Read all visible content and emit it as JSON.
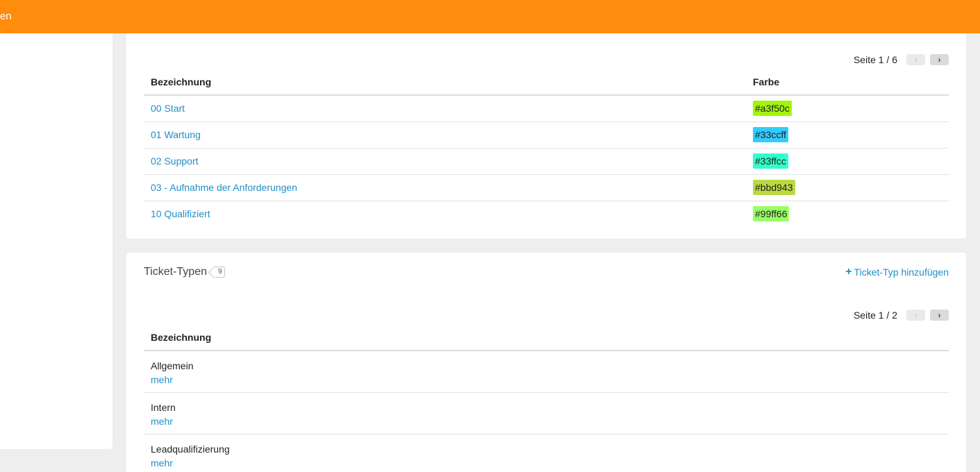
{
  "topbar": {
    "title": "en"
  },
  "tags_section": {
    "pager": {
      "text": "Seite 1 / 6"
    },
    "columns": {
      "name": "Bezeichnung",
      "color": "Farbe"
    },
    "rows": [
      {
        "name": "00 Start",
        "color": "#a3f50c"
      },
      {
        "name": "01 Wartung",
        "color": "#33ccff"
      },
      {
        "name": "02 Support",
        "color": "#33ffcc"
      },
      {
        "name": "03 - Aufnahme der Anforderungen",
        "color": "#bbd943"
      },
      {
        "name": "10 Qualifiziert",
        "color": "#99ff66"
      }
    ]
  },
  "ticket_types": {
    "title": "Ticket-Typen",
    "count": "9",
    "add_label": "Ticket-Typ hinzufügen",
    "pager": {
      "text": "Seite 1 / 2"
    },
    "columns": {
      "name": "Bezeichnung"
    },
    "rows": [
      {
        "name": "Allgemein",
        "more": "mehr"
      },
      {
        "name": "Intern",
        "more": "mehr"
      },
      {
        "name": "Leadqualifizierung",
        "more": "mehr"
      }
    ]
  },
  "icons": {
    "prev": "chevron-left-icon",
    "next": "chevron-right-icon",
    "add": "plus-icon"
  },
  "colors": {
    "brand": "#ff8c0c",
    "link": "#1e8ec9"
  }
}
